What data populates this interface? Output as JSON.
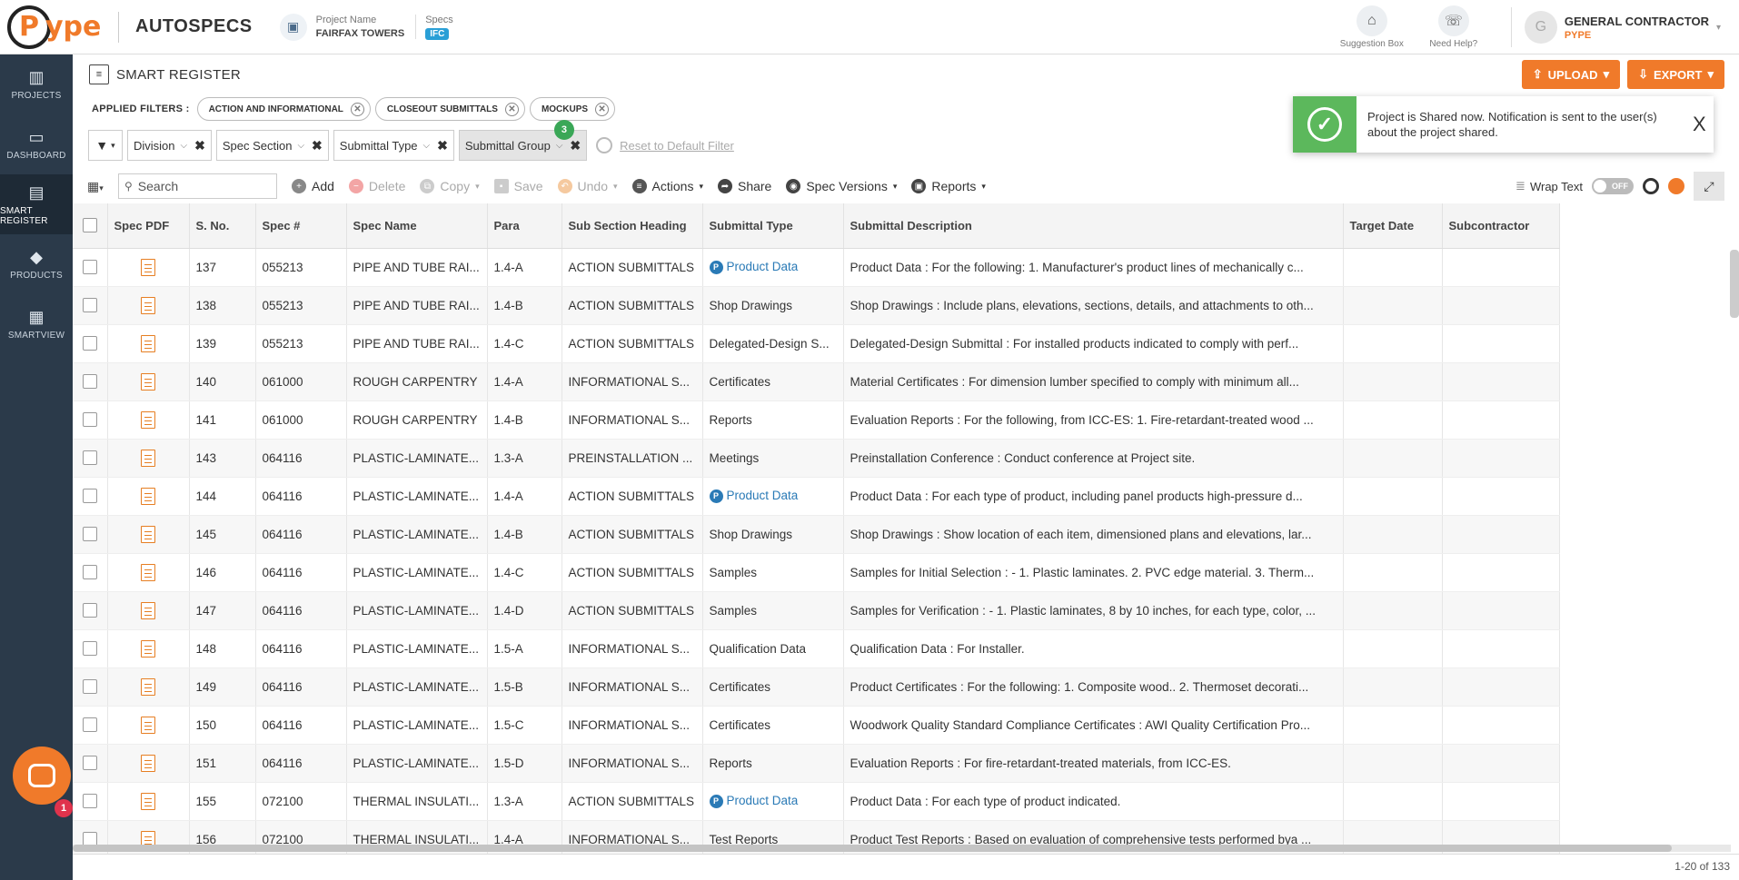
{
  "header": {
    "logo_text": "ype",
    "logo_initial": "P",
    "brand": "AUTOSPECS",
    "project_label": "Project Name",
    "project_name": "FAIRFAX TOWERS",
    "specs_label": "Specs",
    "specs_badge": "IFC",
    "suggestion_box": "Suggestion Box",
    "need_help": "Need Help?",
    "user_initial": "G",
    "user_role": "GENERAL CONTRACTOR",
    "user_org": "PYPE"
  },
  "sidebar": {
    "items": [
      {
        "label": "PROJECTS",
        "icon": "building-icon"
      },
      {
        "label": "DASHBOARD",
        "icon": "monitor-icon"
      },
      {
        "label": "SMART REGISTER",
        "icon": "document-icon"
      },
      {
        "label": "PRODUCTS",
        "icon": "tag-icon"
      },
      {
        "label": "SMARTVIEW",
        "icon": "smartview-icon"
      }
    ],
    "chat_badge": "1"
  },
  "page": {
    "title": "SMART REGISTER",
    "upload_label": "UPLOAD",
    "export_label": "EXPORT"
  },
  "applied_filters": {
    "label": "APPLIED FILTERS :",
    "chips": [
      "ACTION AND INFORMATIONAL",
      "CLOSEOUT SUBMITTALS",
      "MOCKUPS"
    ]
  },
  "toast": {
    "message": "Project is Shared now. Notification is sent to the user(s) about the project shared.",
    "close": "X"
  },
  "filter_bar": {
    "division": "Division",
    "spec_section": "Spec Section",
    "submittal_type": "Submittal Type",
    "submittal_group": "Submittal Group",
    "group_count": "3",
    "reset": "Reset to Default Filter"
  },
  "toolbar": {
    "search_placeholder": "Search",
    "add": "Add",
    "delete": "Delete",
    "copy": "Copy",
    "save": "Save",
    "undo": "Undo",
    "actions": "Actions",
    "share": "Share",
    "spec_versions": "Spec Versions",
    "reports": "Reports",
    "wrap_text": "Wrap Text",
    "toggle": "OFF"
  },
  "table": {
    "columns": [
      "Spec PDF",
      "S. No.",
      "Spec #",
      "Spec Name",
      "Para",
      "Sub Section Heading",
      "Submittal Type",
      "Submittal Description",
      "Target Date",
      "Subcontractor"
    ],
    "rows": [
      {
        "sno": "137",
        "spec": "055213",
        "name": "PIPE AND TUBE RAI...",
        "para": "1.4-A",
        "heading": "ACTION SUBMITTALS",
        "type": "Product Data",
        "product": true,
        "desc": "Product Data : For the following: 1. Manufacturer's product lines of mechanically c..."
      },
      {
        "sno": "138",
        "spec": "055213",
        "name": "PIPE AND TUBE RAI...",
        "para": "1.4-B",
        "heading": "ACTION SUBMITTALS",
        "type": "Shop Drawings",
        "product": false,
        "desc": "Shop Drawings : Include plans, elevations, sections, details, and attachments to oth..."
      },
      {
        "sno": "139",
        "spec": "055213",
        "name": "PIPE AND TUBE RAI...",
        "para": "1.4-C",
        "heading": "ACTION SUBMITTALS",
        "type": "Delegated-Design S...",
        "product": false,
        "desc": "Delegated-Design Submittal : For installed products indicated to comply with perf..."
      },
      {
        "sno": "140",
        "spec": "061000",
        "name": "ROUGH CARPENTRY",
        "para": "1.4-A",
        "heading": "INFORMATIONAL S...",
        "type": "Certificates",
        "product": false,
        "desc": "Material Certificates : For dimension lumber specified to comply with minimum all..."
      },
      {
        "sno": "141",
        "spec": "061000",
        "name": "ROUGH CARPENTRY",
        "para": "1.4-B",
        "heading": "INFORMATIONAL S...",
        "type": "Reports",
        "product": false,
        "desc": "Evaluation Reports : For the following, from ICC-ES: 1. Fire-retardant-treated wood ..."
      },
      {
        "sno": "143",
        "spec": "064116",
        "name": "PLASTIC-LAMINATE...",
        "para": "1.3-A",
        "heading": "PREINSTALLATION ...",
        "type": "Meetings",
        "product": false,
        "desc": "Preinstallation Conference : Conduct conference at Project site."
      },
      {
        "sno": "144",
        "spec": "064116",
        "name": "PLASTIC-LAMINATE...",
        "para": "1.4-A",
        "heading": "ACTION SUBMITTALS",
        "type": "Product Data",
        "product": true,
        "desc": "Product Data : For each type of product, including panel products high-pressure d..."
      },
      {
        "sno": "145",
        "spec": "064116",
        "name": "PLASTIC-LAMINATE...",
        "para": "1.4-B",
        "heading": "ACTION SUBMITTALS",
        "type": "Shop Drawings",
        "product": false,
        "desc": "Shop Drawings : Show location of each item, dimensioned plans and elevations, lar..."
      },
      {
        "sno": "146",
        "spec": "064116",
        "name": "PLASTIC-LAMINATE...",
        "para": "1.4-C",
        "heading": "ACTION SUBMITTALS",
        "type": "Samples",
        "product": false,
        "desc": "Samples for Initial Selection : - 1. Plastic laminates. 2. PVC edge material. 3. Therm..."
      },
      {
        "sno": "147",
        "spec": "064116",
        "name": "PLASTIC-LAMINATE...",
        "para": "1.4-D",
        "heading": "ACTION SUBMITTALS",
        "type": "Samples",
        "product": false,
        "desc": "Samples for Verification : - 1. Plastic laminates, 8 by 10 inches, for each type, color, ..."
      },
      {
        "sno": "148",
        "spec": "064116",
        "name": "PLASTIC-LAMINATE...",
        "para": "1.5-A",
        "heading": "INFORMATIONAL S...",
        "type": "Qualification Data",
        "product": false,
        "desc": "Qualification Data : For Installer."
      },
      {
        "sno": "149",
        "spec": "064116",
        "name": "PLASTIC-LAMINATE...",
        "para": "1.5-B",
        "heading": "INFORMATIONAL S...",
        "type": "Certificates",
        "product": false,
        "desc": "Product Certificates : For the following: 1. Composite wood.. 2. Thermoset decorati..."
      },
      {
        "sno": "150",
        "spec": "064116",
        "name": "PLASTIC-LAMINATE...",
        "para": "1.5-C",
        "heading": "INFORMATIONAL S...",
        "type": "Certificates",
        "product": false,
        "desc": "Woodwork Quality Standard Compliance Certificates : AWI Quality Certification Pro..."
      },
      {
        "sno": "151",
        "spec": "064116",
        "name": "PLASTIC-LAMINATE...",
        "para": "1.5-D",
        "heading": "INFORMATIONAL S...",
        "type": "Reports",
        "product": false,
        "desc": "Evaluation Reports : For fire-retardant-treated materials, from ICC-ES."
      },
      {
        "sno": "155",
        "spec": "072100",
        "name": "THERMAL INSULATI...",
        "para": "1.3-A",
        "heading": "ACTION SUBMITTALS",
        "type": "Product Data",
        "product": true,
        "desc": "Product Data : For each type of product indicated."
      },
      {
        "sno": "156",
        "spec": "072100",
        "name": "THERMAL INSULATI...",
        "para": "1.4-A",
        "heading": "INFORMATIONAL S...",
        "type": "Test Reports",
        "product": false,
        "desc": "Product Test Reports : Based on evaluation of comprehensive tests performed bya ..."
      }
    ]
  },
  "footer": {
    "pager": "1-20 of 133"
  },
  "colors": {
    "accent": "#f07a2a",
    "sidebar": "#2b3a4a",
    "success": "#5cb85c",
    "link": "#2a7ab6"
  }
}
